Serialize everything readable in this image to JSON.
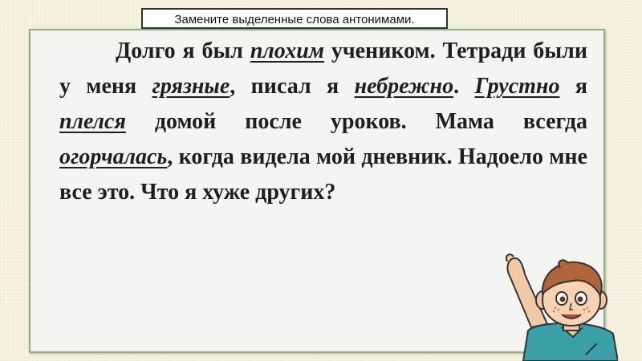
{
  "instruction": "Замените  выделенные слова антонимами.",
  "text": {
    "s1_a": "Долго я был ",
    "s1_word": "плохим",
    "s1_b": " учеником. Тетради были у меня ",
    "s2_word": "грязные",
    "s2_b": ", писал я ",
    "s3_word": "небрежно",
    "s3_b": ". ",
    "s4_word": "Грустно",
    "s4_b": " я ",
    "s5_word": "плелся",
    "s5_b": " домой после уроков. Мама всегда ",
    "s6_word": "огорчалась",
    "s6_b": ", когда видела мой дневник. Надоело мне все это. Что я хуже других?"
  },
  "colors": {
    "frame_border": "#8bb07a",
    "shirt": "#3aa0a8",
    "hair": "#b0653a"
  },
  "illustration": {
    "icon": "waving-boy-icon"
  }
}
